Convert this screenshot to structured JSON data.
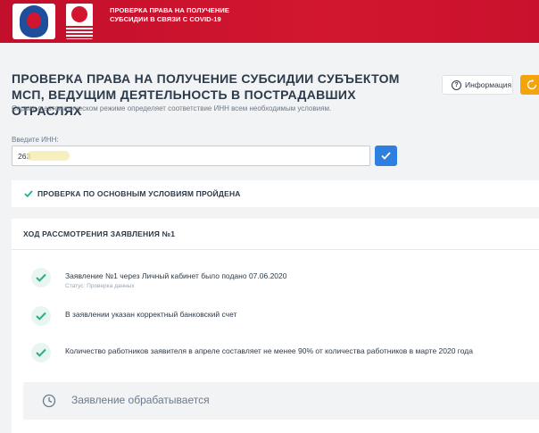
{
  "header": {
    "title": "ПРОВЕРКА ПРАВА НА ПОЛУЧЕНИЕ СУБСИДИИ В СВЯЗИ С COVID-19",
    "brand_color": "#c8102e"
  },
  "page": {
    "title": "ПРОВЕРКА ПРАВА НА ПОЛУЧЕНИЕ СУБСИДИИ СУБЪЕКТОМ МСП, ВЕДУЩИМ ДЕЯТЕЛЬНОСТЬ В ПОСТРАДАВШИХ ОТРАСЛЯХ",
    "subtitle": "Сервис в автоматическом режиме определяет соответствие ИНН всем необходимым условиям."
  },
  "toolbar": {
    "info_label": "Информация",
    "info_icon": "question-circle-icon",
    "extra_icon": "refresh-icon",
    "accent_color": "#f4a40b"
  },
  "inn": {
    "label": "Введите ИНН:",
    "value": "263",
    "submit_icon": "check-icon",
    "submit_color": "#2f7fe0"
  },
  "check": {
    "passed_text": "ПРОВЕРКА ПО ОСНОВНЫМ УСЛОВИЯМ ПРОЙДЕНА",
    "icon": "check-icon",
    "color": "#27ae8a"
  },
  "progress": {
    "title": "ХОД РАССМОТРЕНИЯ ЗАЯВЛЕНИЯ №1",
    "steps": [
      {
        "text": "Заявление №1 через Личный кабинет было подано 07.06.2020",
        "status": "Статус: Проверка данных"
      },
      {
        "text": "В заявлении указан корректный банковский счет",
        "status": ""
      },
      {
        "text": "Количество работников заявителя в апреле составляет не менее 90% от количества работников в марте 2020 года",
        "status": ""
      }
    ],
    "processing_text": "Заявление обрабатывается",
    "processing_icon": "clock-icon"
  }
}
